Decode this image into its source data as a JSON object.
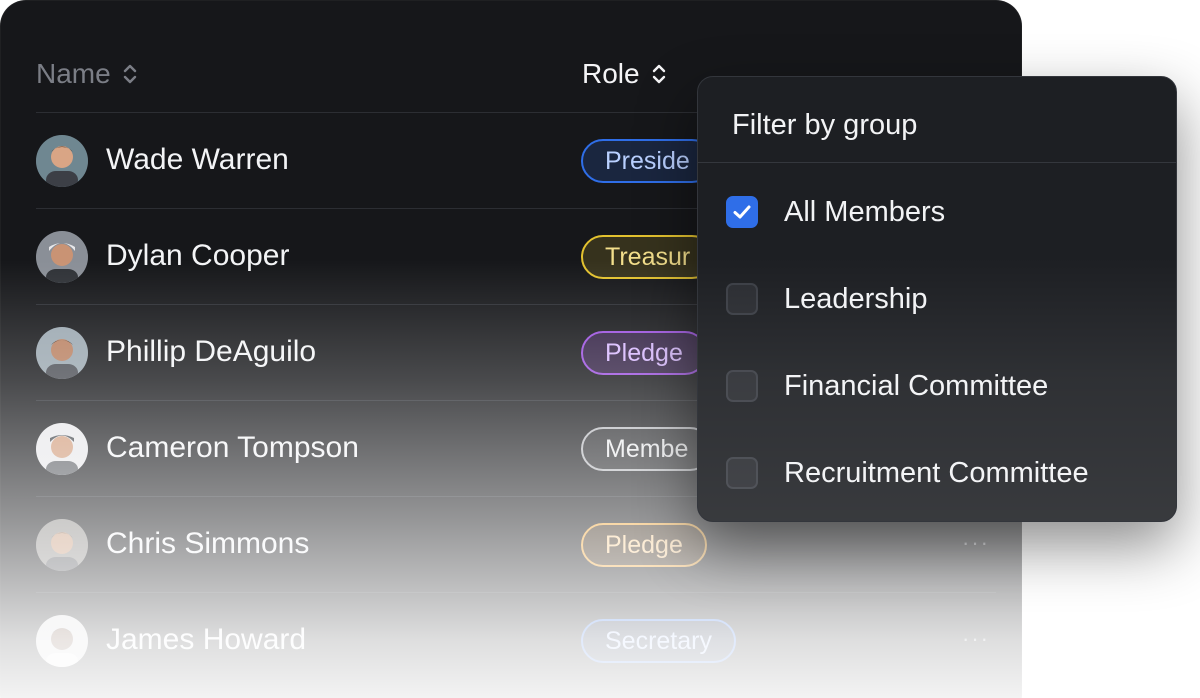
{
  "table": {
    "columns": {
      "name": "Name",
      "role": "Role"
    },
    "rows": [
      {
        "name": "Wade Warren",
        "role": "Preside",
        "role_style": "blue"
      },
      {
        "name": "Dylan Cooper",
        "role": "Treasur",
        "role_style": "yellow"
      },
      {
        "name": "Phillip DeAguilo",
        "role": "Pledge",
        "role_style": "purple"
      },
      {
        "name": "Cameron Tompson",
        "role": "Membe",
        "role_style": "gray"
      },
      {
        "name": "Chris Simmons",
        "role": "Pledge",
        "role_style": "amber",
        "more": "···"
      },
      {
        "name": "James Howard",
        "role": "Secretary",
        "role_style": "blue",
        "more": "···"
      }
    ]
  },
  "filter": {
    "title": "Filter by group",
    "options": [
      {
        "label": "All Members",
        "checked": true
      },
      {
        "label": "Leadership",
        "checked": false
      },
      {
        "label": "Financial Committee",
        "checked": false
      },
      {
        "label": "Recruitment Committee",
        "checked": false
      }
    ]
  },
  "colors": {
    "panel": "#16171a",
    "accent": "#2f6ee8",
    "badge_blue": "#2f6ee8",
    "badge_yellow": "#e3c22f",
    "badge_purple": "#9b4fe0",
    "badge_gray": "#b6b8bd",
    "badge_amber": "#f2a93b"
  }
}
